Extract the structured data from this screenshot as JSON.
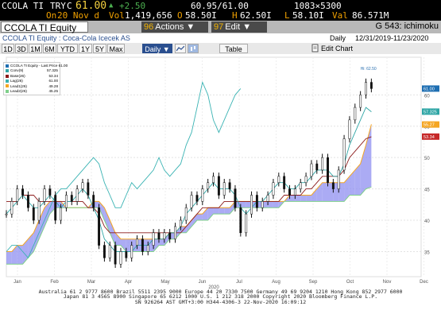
{
  "quote": {
    "ticker": "CCOLA TI",
    "currency": "TRY",
    "flag": "C",
    "price": "61.00",
    "change": "+2.50",
    "bid_ask": "60.95/61.00",
    "size": "1083×5300",
    "date_label": "On",
    "date": "20 Nov d",
    "vol_label": "Vol",
    "vol": "1,419,656",
    "open_label": "O",
    "open": "58.50I",
    "high_label": "H",
    "high": "62.50I",
    "low_label": "L",
    "low": "58.10I",
    "val_label": "Val",
    "val": "86.571M"
  },
  "security_bar": {
    "input_value": "CCOLA TI Equity",
    "actions_num": "96",
    "actions_label": "Actions ▼",
    "edit_num": "97",
    "edit_label": "Edit ▼",
    "function_code": "G 543: ichimoku"
  },
  "title_bar": {
    "title": "CCOLA TI Equity : Coca-Cola Icecek AS",
    "frequency": "Daily",
    "range": "12/31/2019-11/23/2020"
  },
  "toolbar": {
    "periods": [
      "1D",
      "3D",
      "1M",
      "6M",
      "YTD",
      "1Y",
      "5Y",
      "Max"
    ],
    "freq": "Daily ▼",
    "table": "Table",
    "edit_chart": "Edit Chart"
  },
  "legend": {
    "title": "CCOLA TI Equity - Last Price 61.00",
    "items": [
      {
        "name": "Conv(9)",
        "value": "57.325",
        "color": "#2ea5a5"
      },
      {
        "name": "Base(26)",
        "value": "53.34",
        "color": "#8b1a1a"
      },
      {
        "name": "Lag(26)",
        "value": "61.00",
        "color": "#3ab3b3"
      },
      {
        "name": "Lead1(26)",
        "value": "49.28",
        "color": "#f5a623"
      },
      {
        "name": "Lead2(26)",
        "value": "45.25",
        "color": "#7fd08a"
      }
    ]
  },
  "chart_data": {
    "type": "line",
    "x_month_labels": [
      "Jan",
      "Feb",
      "Mar",
      "Apr",
      "May",
      "Jun",
      "Jul",
      "Aug",
      "Sep",
      "Oct",
      "Nov",
      "Dec"
    ],
    "x_year_label": "2020",
    "y_ticks": [
      35,
      40,
      45,
      50,
      55,
      60
    ],
    "ylim": [
      31,
      66
    ],
    "hi_label": "Hi: 62.50",
    "right_badges": [
      {
        "value": "61.00",
        "color": "#1f6fb2"
      },
      {
        "value": "57.325",
        "color": "#2ea5a5"
      },
      {
        "value": "55.27",
        "color": "#f5a623"
      },
      {
        "value": "53.34",
        "color": "#c62828"
      }
    ],
    "series": [
      {
        "name": "Last Price",
        "values": [
          41,
          43,
          45,
          44,
          42,
          40,
          43,
          45,
          44,
          40,
          42,
          44,
          43,
          45,
          46,
          44,
          42,
          36,
          34,
          36,
          33,
          35,
          34,
          36,
          37,
          35,
          36,
          38,
          37,
          38,
          37,
          39,
          40,
          42,
          44,
          43,
          45,
          46,
          47,
          44,
          46,
          45,
          42,
          38,
          41,
          44,
          42,
          43,
          44,
          46,
          47,
          45,
          44,
          45,
          46,
          47,
          49,
          48,
          50,
          46,
          45,
          48,
          53,
          56,
          58,
          60,
          62,
          61
        ]
      },
      {
        "name": "Conv(9)",
        "values": [
          41,
          42,
          43,
          44,
          43,
          42,
          42,
          43,
          44,
          43,
          42,
          43,
          43,
          44,
          45,
          44,
          42,
          40,
          37,
          36,
          35,
          35,
          35,
          35,
          36,
          36,
          36,
          37,
          37,
          37,
          38,
          38,
          39,
          41,
          42,
          43,
          44,
          45,
          46,
          45,
          45,
          45,
          44,
          42,
          41,
          42,
          43,
          43,
          44,
          45,
          46,
          46,
          45,
          45,
          46,
          46,
          47,
          48,
          48,
          48,
          47,
          47,
          49,
          52,
          54,
          56,
          58,
          57.3
        ]
      },
      {
        "name": "Base(26)",
        "values": [
          43,
          43,
          43,
          44,
          44,
          44,
          43,
          43,
          43,
          43,
          43,
          43,
          43,
          43,
          43,
          42,
          42,
          41,
          39,
          38,
          38,
          38,
          38,
          38,
          38,
          38,
          38,
          38,
          38,
          38,
          38,
          38,
          38,
          39,
          40,
          41,
          42,
          42,
          42,
          42,
          43,
          43,
          43,
          43,
          43,
          43,
          43,
          43,
          43,
          43,
          43,
          44,
          44,
          44,
          44,
          45,
          45,
          46,
          47,
          47,
          47,
          47,
          48,
          50,
          51,
          52,
          53,
          53.3
        ]
      },
      {
        "name": "Lag(26)",
        "values": [
          35,
          36,
          36,
          35,
          34,
          36,
          38,
          40,
          42,
          44,
          45,
          45,
          46,
          47,
          48,
          49,
          50,
          49,
          46,
          44,
          42,
          42,
          44,
          46,
          45,
          46,
          47,
          48,
          50,
          48,
          47,
          48,
          49,
          52,
          54,
          58,
          62,
          60,
          56,
          54,
          56,
          58,
          60,
          61,
          null,
          null,
          null,
          null,
          null,
          null,
          null,
          null,
          null,
          null,
          null,
          null,
          null,
          null,
          null,
          null,
          null,
          null,
          null,
          null,
          null,
          null,
          null,
          null
        ]
      },
      {
        "name": "Lead1(26)",
        "values": [
          35,
          35,
          36,
          36,
          37,
          38,
          40,
          42,
          43,
          43,
          43,
          42,
          42,
          42,
          42,
          42,
          43,
          43,
          42,
          40,
          38,
          37,
          37,
          37,
          37,
          37,
          37,
          37,
          37,
          37,
          38,
          38,
          39,
          39,
          40,
          41,
          41,
          42,
          42,
          42,
          42,
          42,
          43,
          43,
          43,
          43,
          43,
          43,
          43,
          43,
          43,
          43,
          44,
          44,
          44,
          44,
          44,
          45,
          46,
          46,
          46,
          46,
          46,
          47,
          48,
          49,
          52,
          55.3
        ]
      },
      {
        "name": "Lead2(26)",
        "values": [
          33,
          33,
          33,
          33,
          34,
          35,
          37,
          39,
          41,
          42,
          42,
          42,
          42,
          42,
          42,
          42,
          42,
          42,
          40,
          38,
          36,
          36,
          35,
          35,
          35,
          35,
          35,
          35,
          36,
          36,
          37,
          37,
          38,
          38,
          39,
          40,
          40,
          40,
          41,
          41,
          41,
          41,
          42,
          42,
          42,
          42,
          42,
          42,
          42,
          42,
          42,
          43,
          43,
          43,
          43,
          43,
          43,
          43,
          43,
          43,
          43,
          43,
          43,
          44,
          44,
          44,
          45,
          45.3
        ]
      }
    ]
  },
  "footer": {
    "line1": "Australia 61 2 9777 8600  Brazil 5511 2395 9000  Europe 44 20 7330 7500  Germany 49 69 9204 1210  Hong Kong 852 2977 6000",
    "line2": "Japan 81 3 4565 8900        Singapore 65 6212 1000        U.S. 1 212 318 2000        Copyright 2020 Bloomberg Finance L.P.",
    "line3": "SN 926264 AST  GMT+3:00 H344-4306-3 22-Nov-2020 16:09:12"
  }
}
